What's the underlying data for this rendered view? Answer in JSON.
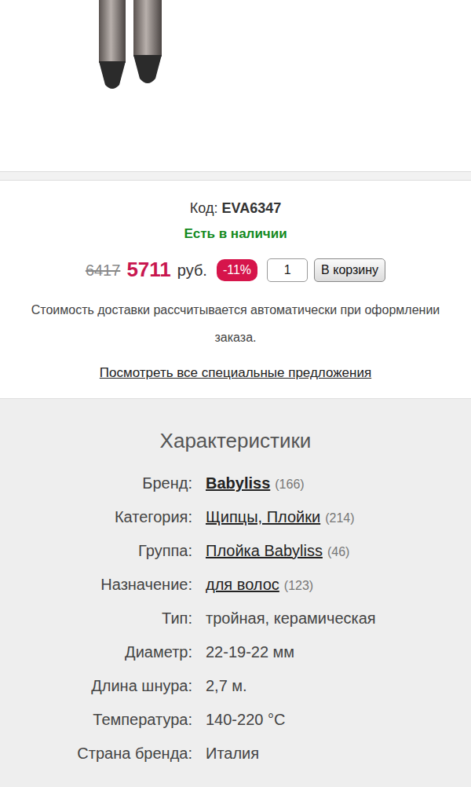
{
  "product": {
    "code_label": "Код:",
    "code": "EVA6347",
    "availability": "Есть в наличии",
    "old_price": "6417",
    "price": "5711",
    "currency": "руб.",
    "discount": "-11%",
    "quantity": "1",
    "cart_button": "В корзину",
    "delivery_note": "Стоимость доставки рассчитывается автоматически при оформлении заказа.",
    "offers_link": "Посмотреть все специальные предложения"
  },
  "specs": {
    "title": "Характеристики",
    "rows": [
      {
        "label": "Бренд:",
        "value": "Babyliss",
        "kind": "brand",
        "count": "(166)"
      },
      {
        "label": "Категория:",
        "value": "Щипцы, Плойки",
        "kind": "link",
        "count": "(214)"
      },
      {
        "label": "Группа:",
        "value": "Плойка Babyliss",
        "kind": "link",
        "count": "(46)"
      },
      {
        "label": "Назначение:",
        "value": "для волос",
        "kind": "link",
        "count": "(123)"
      },
      {
        "label": "Тип:",
        "value": "тройная, керамическая",
        "kind": "plain",
        "count": ""
      },
      {
        "label": "Диаметр:",
        "value": "22-19-22 мм",
        "kind": "plain",
        "count": ""
      },
      {
        "label": "Длина шнура:",
        "value": "2,7 м.",
        "kind": "plain",
        "count": ""
      },
      {
        "label": "Температура:",
        "value": "140-220 °C",
        "kind": "plain",
        "count": ""
      },
      {
        "label": "Страна бренда:",
        "value": "Италия",
        "kind": "plain",
        "count": ""
      }
    ]
  }
}
